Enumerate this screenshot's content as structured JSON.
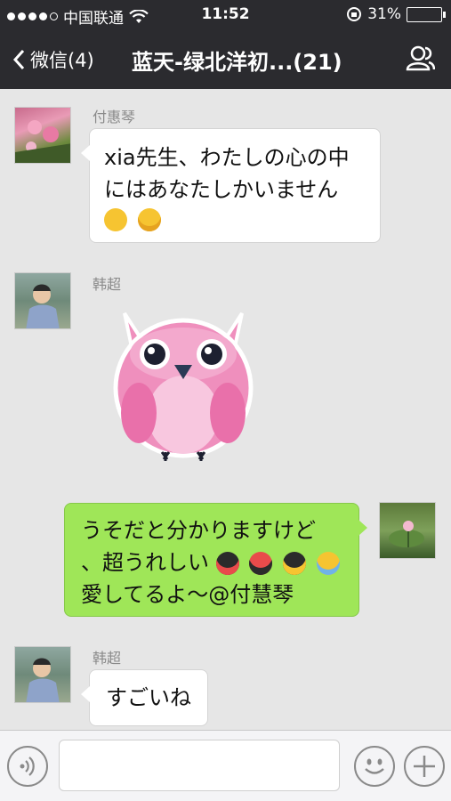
{
  "status_bar": {
    "carrier": "中国联通",
    "time": "11:52",
    "battery_percent": "31%",
    "battery_level": 0.31,
    "icons": [
      "signal-dots-icon",
      "wifi-icon",
      "orientation-lock-icon",
      "battery-icon"
    ]
  },
  "nav": {
    "back_label": "微信(4)",
    "title": "蓝天-绿北洋初...(21)",
    "icons": [
      "chevron-left-icon",
      "group-members-icon"
    ]
  },
  "messages": [
    {
      "side": "left",
      "sender": "付惠琴",
      "line1": "xia先生、わたしの心の中",
      "line2": "にはあなたしかいません",
      "emojis": [
        "winking-tongue-emoji",
        "heart-eyes-emoji"
      ]
    },
    {
      "side": "left",
      "sender": "韩超",
      "sticker": "pink-owl-sticker"
    },
    {
      "side": "right",
      "line1": "うそだと分かりますけど",
      "line2": "、超うれしい",
      "line3": "愛してるよ～@付慧琴",
      "emojis": [
        "penguin-kiss-emoji",
        "penguin-hug-emoji",
        "penguin-couple-emoji",
        "laughing-tears-emoji"
      ]
    },
    {
      "side": "left",
      "sender": "韩超",
      "text": "すごいね"
    }
  ],
  "input_bar": {
    "placeholder": "",
    "icons": [
      "voice-icon",
      "emoji-face-icon",
      "plus-icon"
    ]
  },
  "colors": {
    "bar_bg": "#2b2b2f",
    "chat_bg": "#e6e6e6",
    "bubble_green": "#9fe658",
    "bubble_white": "#ffffff"
  }
}
